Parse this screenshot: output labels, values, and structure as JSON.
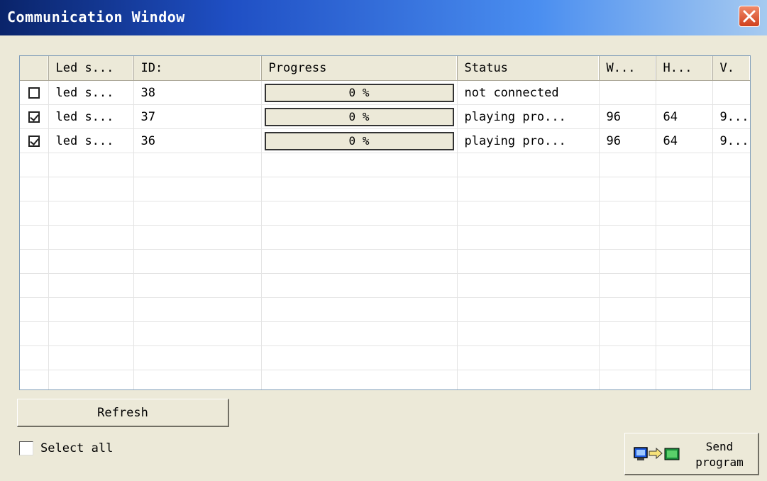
{
  "window": {
    "title": "Communication Window"
  },
  "table": {
    "columns": [
      "",
      "Led s...",
      "ID:",
      "Progress",
      "Status",
      "W...",
      "H...",
      "V."
    ],
    "rows": [
      {
        "checked": false,
        "name": "led s...",
        "id": "38",
        "progress_text": "0 %",
        "progress": 0,
        "status": "not connected",
        "w": "",
        "h": "",
        "v": ""
      },
      {
        "checked": true,
        "name": "led s...",
        "id": "37",
        "progress_text": "0 %",
        "progress": 0,
        "status": "playing pro...",
        "w": "96",
        "h": "64",
        "v": "9..."
      },
      {
        "checked": true,
        "name": "led s...",
        "id": "36",
        "progress_text": "0 %",
        "progress": 0,
        "status": "playing pro...",
        "w": "96",
        "h": "64",
        "v": "9..."
      }
    ],
    "empty_rows": 10
  },
  "controls": {
    "refresh_label": "Refresh",
    "select_all_label": "Select all",
    "send_label": "Send\nprogram"
  },
  "icons": {
    "close": "close-icon",
    "send": "send-program-icon"
  },
  "colors": {
    "titlebar_start": "#0a246a",
    "titlebar_end": "#a6caf0",
    "window_bg": "#ece9d8",
    "close_button": "#d0401c"
  }
}
